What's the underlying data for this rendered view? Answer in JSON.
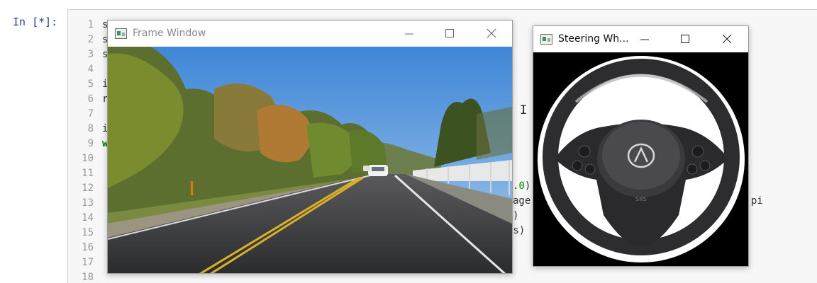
{
  "cell": {
    "prompt": "In [*]:",
    "line_numbers": [
      "1",
      "2",
      "3",
      "4",
      "5",
      "6",
      "7",
      "8",
      "9",
      "10",
      "11",
      "12",
      "13",
      "14",
      "15",
      "16",
      "17",
      "18"
    ],
    "code_visible_lines": [
      "s",
      "s",
      "s",
      "",
      "i",
      "r",
      "",
      "i",
      "w"
    ],
    "code_fragments": {
      "line12_prefix": ".",
      "line12_number": "0",
      "line12_suffix": ")",
      "line13_left": "age",
      "line13_right": "pi",
      "line14": ")",
      "line15": "ws)"
    }
  },
  "frame_window": {
    "title": "Frame Window",
    "icon": "app-window-icon",
    "image": "dash-camera-road-frame"
  },
  "wheel_window": {
    "title": "Steering Wh...",
    "icon": "app-window-icon",
    "image": "steering-wheel"
  },
  "colors": {
    "prompt": "#303f9f",
    "editor_bg": "#f7f7f7",
    "editor_border": "#cfcfcf",
    "line_number": "#999999",
    "keyword": "#008000",
    "number": "#008800"
  }
}
